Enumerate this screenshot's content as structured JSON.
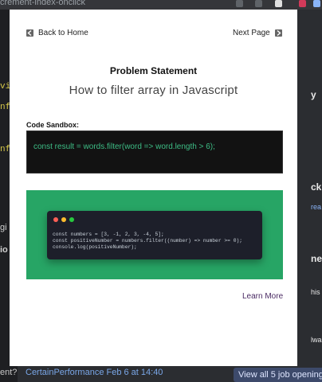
{
  "browser": {
    "url_fragment": "crement-index-onclick"
  },
  "background": {
    "left_code_lines": [
      "vi",
      "nf",
      "nf"
    ],
    "left_text": [
      "gi",
      "io",
      "ent?"
    ],
    "right_text": [
      "y",
      "ck",
      "rea",
      "ne",
      "his",
      "lwa"
    ],
    "bottom_link": "CertainPerformance Feb 6 at 14:40",
    "job_button": "View all 5 job openings"
  },
  "modal": {
    "back_label": "Back to Home",
    "next_label": "Next Page",
    "title": "Problem Statement",
    "subtitle": "How to filter array in Javascript",
    "sandbox_label": "Code Sandbox:",
    "sandbox_code": "const result = words.filter(word => word.length > 6);",
    "learn_more": "Learn More",
    "image_code": {
      "line1": "const numbers = [3, -1, 2, 3, -4, 5];",
      "line2": "const positiveNumber = numbers.filter((number) => number >= 0);",
      "line3": "console.log(positiveNumber);"
    }
  },
  "colors": {
    "sandbox_text": "#3dbd85",
    "image_bg": "#27a565",
    "learn_more": "#4a2a63",
    "dot_red": "#ff5f56",
    "dot_yellow": "#ffbd2e",
    "dot_green": "#27c93f"
  }
}
